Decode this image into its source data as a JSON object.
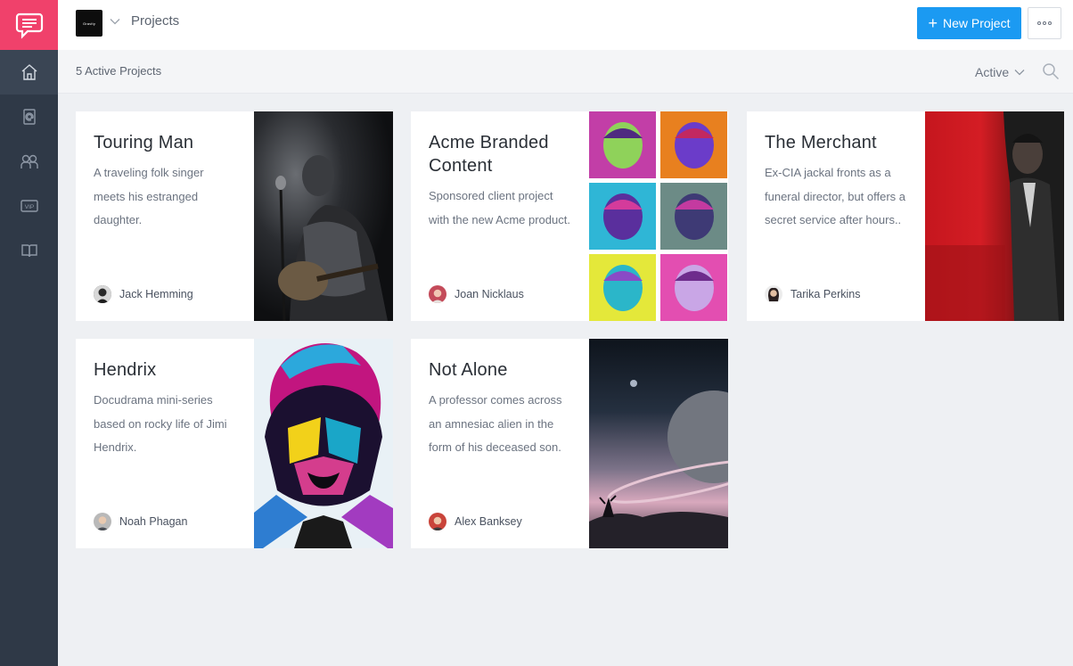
{
  "app": {
    "workspace_logo_text": "Gravity",
    "breadcrumb": "Projects",
    "new_project_label": "New Project"
  },
  "subbar": {
    "count_text": "5 Active Projects",
    "filter_value": "Active"
  },
  "sidebar": {
    "items": [
      {
        "icon": "home-icon",
        "active": true
      },
      {
        "icon": "contacts-icon"
      },
      {
        "icon": "team-icon"
      },
      {
        "icon": "vip-icon",
        "label": "VIP"
      },
      {
        "icon": "book-icon"
      }
    ]
  },
  "colors": {
    "brand": "#f0416b",
    "primary_button": "#1b9af2",
    "sidebar": "#2f3947"
  },
  "projects": [
    {
      "title": "Touring Man",
      "description": "A traveling folk singer meets his estranged daughter.",
      "owner": "Jack Hemming"
    },
    {
      "title": "Acme Branded Content",
      "description": "Sponsored client project with the new Acme product.",
      "owner": "Joan Nicklaus"
    },
    {
      "title": "The Merchant",
      "description": "Ex-CIA jackal fronts as a funeral director, but offers a secret service after hours..",
      "owner": "Tarika Perkins"
    },
    {
      "title": "Hendrix",
      "description": "Docudrama mini-series based on rocky life of Jimi Hendrix.",
      "owner": "Noah Phagan"
    },
    {
      "title": "Not Alone",
      "description": "A professor comes across an amnesiac alien in the form of his deceased son.",
      "owner": "Alex Banksey"
    }
  ]
}
